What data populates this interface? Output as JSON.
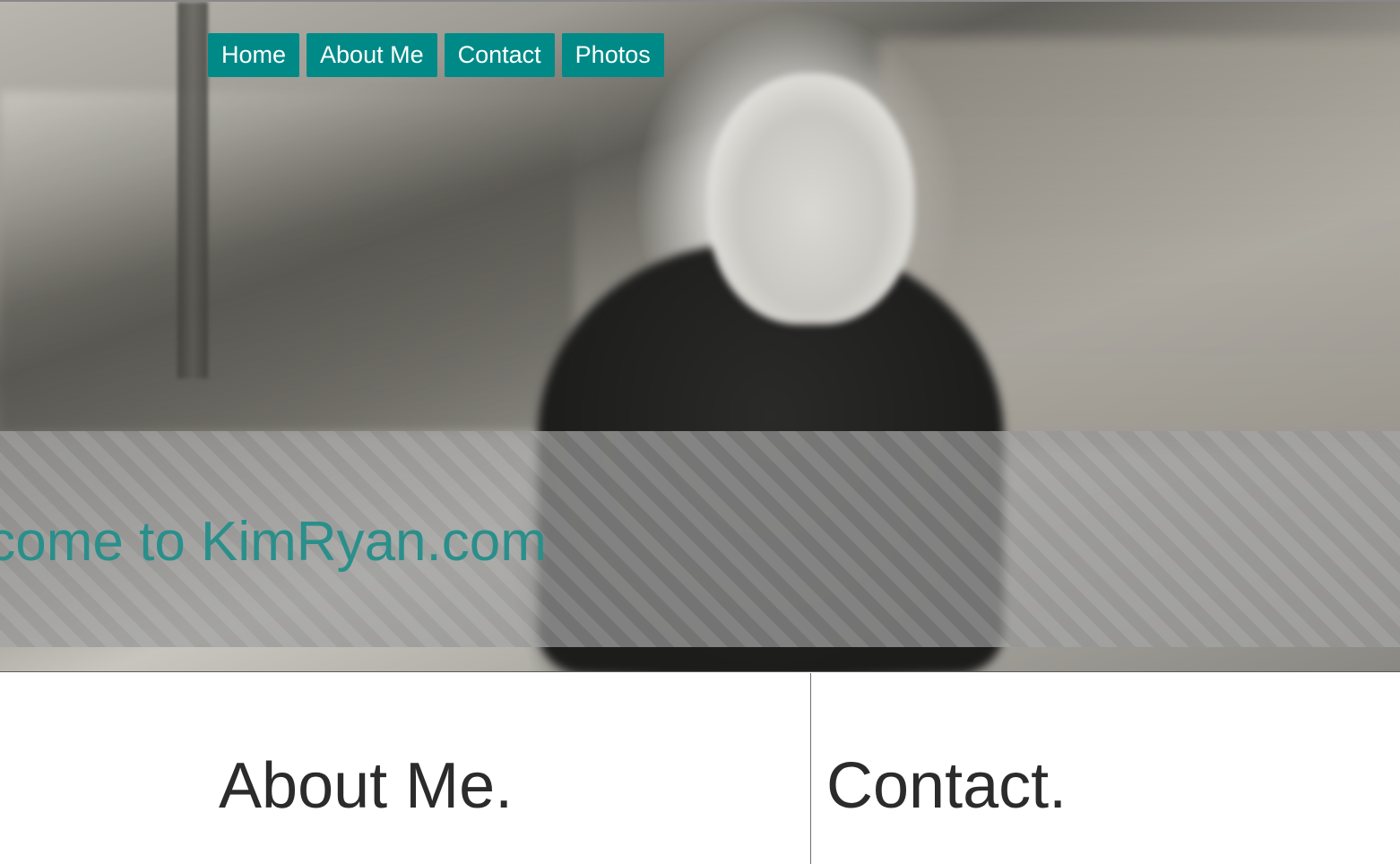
{
  "nav": {
    "items": [
      {
        "label": "Home"
      },
      {
        "label": "About Me"
      },
      {
        "label": "Contact"
      },
      {
        "label": "Photos"
      }
    ]
  },
  "hero": {
    "welcome_text": "elcome to KimRyan.com"
  },
  "sections": {
    "about_heading": "About Me.",
    "contact_heading": "Contact."
  },
  "colors": {
    "accent": "#008a87",
    "welcome_text": "#2a8f8b",
    "heading_text": "#2b2b2b"
  }
}
